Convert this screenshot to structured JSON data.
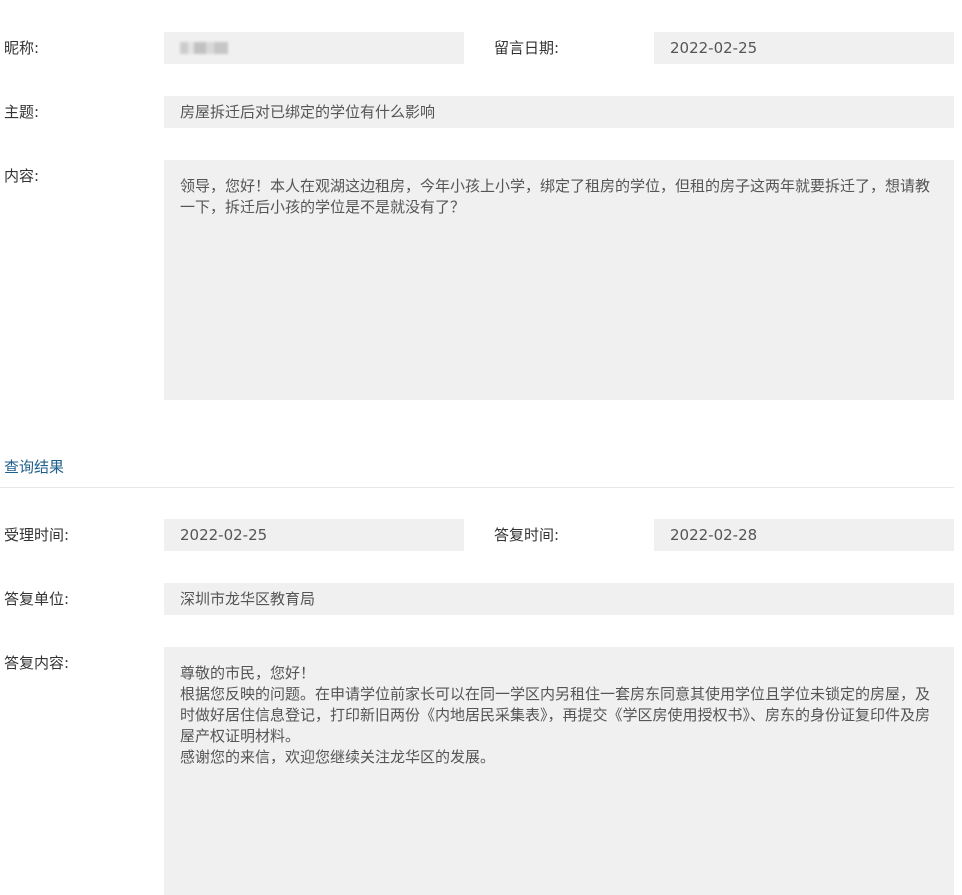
{
  "message": {
    "nickname_label": "昵称:",
    "date_label": "留言日期:",
    "date_value": "2022-02-25",
    "subject_label": "主题:",
    "subject_value": "房屋拆迁后对已绑定的学位有什么影响",
    "content_label": "内容:",
    "content_value": "领导，您好！本人在观湖这边租房，今年小孩上小学，绑定了租房的学位，但租的房子这两年就要拆迁了，想请教一下，拆迁后小孩的学位是不是就没有了？"
  },
  "result": {
    "section_title": "查询结果",
    "accept_time_label": "受理时间:",
    "accept_time_value": "2022-02-25",
    "reply_time_label": "答复时间:",
    "reply_time_value": "2022-02-28",
    "reply_unit_label": "答复单位:",
    "reply_unit_value": "深圳市龙华区教育局",
    "reply_content_label": "答复内容:",
    "reply_lines": [
      "尊敬的市民，您好！",
      "根据您反映的问题。在申请学位前家长可以在同一学区内另租住一套房东同意其使用学位且学位未锁定的房屋，及时做好居住信息登记，打印新旧两份《内地居民采集表》，再提交《学区房使用授权书》、房东的身份证复印件及房屋产权证明材料。",
      "感谢您的来信，欢迎您继续关注龙华区的发展。"
    ]
  }
}
